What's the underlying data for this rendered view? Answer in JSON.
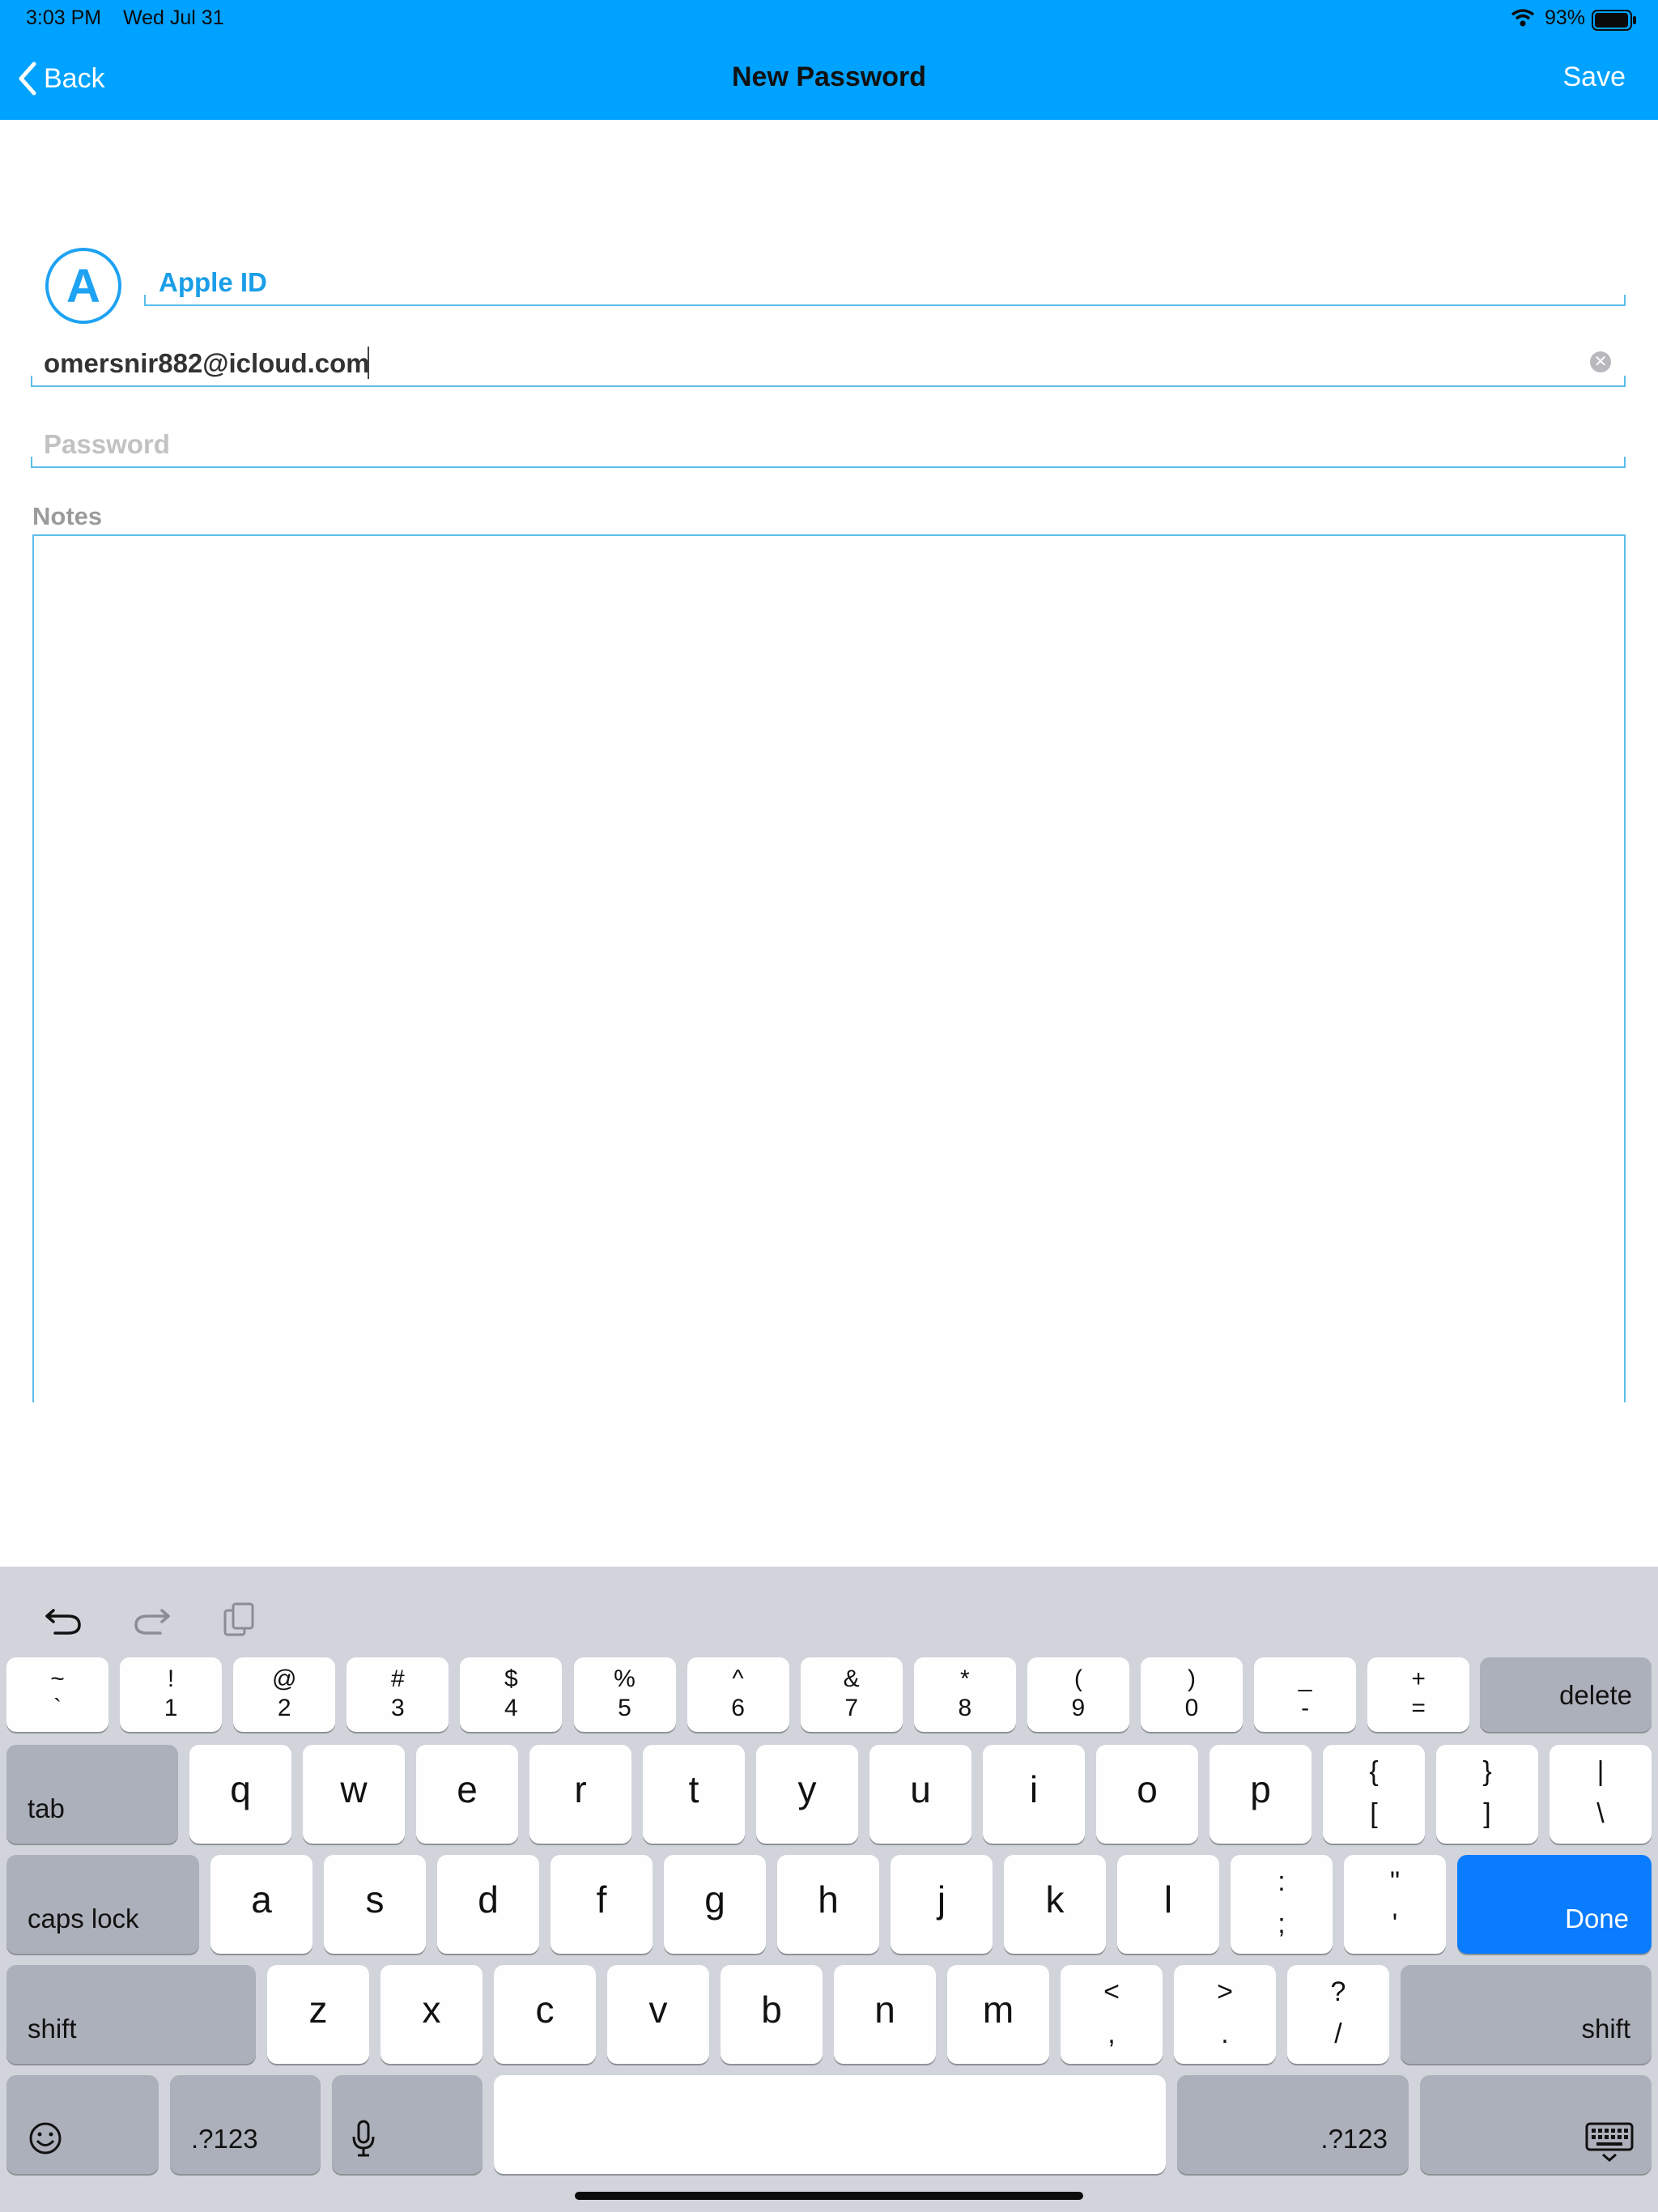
{
  "status_bar": {
    "time": "3:03 PM",
    "date": "Wed Jul 31",
    "battery": "93%",
    "icons": [
      "wifi-icon",
      "battery-icon"
    ]
  },
  "nav": {
    "back_label": "Back",
    "title": "New Password",
    "save_label": "Save"
  },
  "form": {
    "avatar_letter": "A",
    "title_value": "Apple ID",
    "username_value": "omersnir882@icloud.com",
    "password_placeholder": "Password",
    "notes_label": "Notes"
  },
  "keyboard": {
    "toolbar": [
      "undo-icon",
      "redo-icon",
      "paste-icon"
    ],
    "row1": [
      {
        "top": "~",
        "bottom": "`"
      },
      {
        "top": "!",
        "bottom": "1"
      },
      {
        "top": "@",
        "bottom": "2"
      },
      {
        "top": "#",
        "bottom": "3"
      },
      {
        "top": "$",
        "bottom": "4"
      },
      {
        "top": "%",
        "bottom": "5"
      },
      {
        "top": "^",
        "bottom": "6"
      },
      {
        "top": "&",
        "bottom": "7"
      },
      {
        "top": "*",
        "bottom": "8"
      },
      {
        "top": "(",
        "bottom": "9"
      },
      {
        "top": ")",
        "bottom": "0"
      },
      {
        "top": "_",
        "bottom": "-"
      },
      {
        "top": "+",
        "bottom": "="
      }
    ],
    "delete_label": "delete",
    "tab_label": "tab",
    "row2": [
      "q",
      "w",
      "e",
      "r",
      "t",
      "y",
      "u",
      "i",
      "o",
      "p"
    ],
    "row2_pairs": [
      {
        "top": "{",
        "bottom": "["
      },
      {
        "top": "}",
        "bottom": "]"
      },
      {
        "top": "|",
        "bottom": "\\"
      }
    ],
    "caps_label": "caps lock",
    "row3": [
      "a",
      "s",
      "d",
      "f",
      "g",
      "h",
      "j",
      "k",
      "l"
    ],
    "row3_pairs": [
      {
        "top": ":",
        "bottom": ";"
      },
      {
        "top": "\"",
        "bottom": "'"
      }
    ],
    "done_label": "Done",
    "shift_label": "shift",
    "row4": [
      "z",
      "x",
      "c",
      "v",
      "b",
      "n",
      "m"
    ],
    "row4_pairs": [
      {
        "top": "<",
        "bottom": ","
      },
      {
        "top": ">",
        "bottom": "."
      },
      {
        "top": "?",
        "bottom": "/"
      }
    ],
    "numbers_label": ".?123",
    "bottom_icons": [
      "emoji-icon",
      "microphone-icon",
      "keyboard-dismiss-icon"
    ]
  }
}
